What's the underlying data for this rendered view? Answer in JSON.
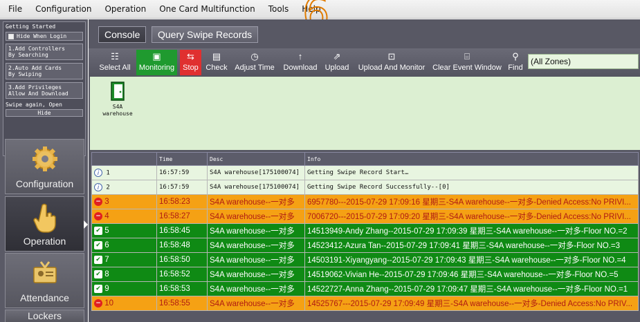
{
  "menu": [
    "File",
    "Configuration",
    "Operation",
    "One Card Multifunction",
    "Tools",
    "Help"
  ],
  "overlay_number": "6",
  "getting_started": {
    "title": "Getting Started",
    "hide_when_login": "Hide When Login",
    "steps": [
      "1.Add Controllers\nBy Searching",
      "2.Auto Add Cards\nBy Swiping",
      "3.Add Privileges\nAllow And Download"
    ],
    "note": "Swipe again, Open",
    "hide_label": "Hide"
  },
  "nav": {
    "configuration": "Configuration",
    "operation": "Operation",
    "attendance": "Attendance",
    "lockers": "Lockers"
  },
  "tabs": {
    "console": "Console",
    "query": "Query Swipe Records"
  },
  "toolbar": {
    "select_all": "Select All",
    "monitoring": "Monitoring",
    "stop": "Stop",
    "check": "Check",
    "adjust_time": "Adjust Time",
    "download": "Download",
    "upload": "Upload",
    "upload_and_monitor": "Upload And Monitor",
    "clear_event_window": "Clear Event Window",
    "find": "Find",
    "zones_value": "(All Zones)"
  },
  "device": {
    "label": "S4A\nwarehouse"
  },
  "grid": {
    "columns": [
      "",
      "Time",
      "Desc",
      "Info"
    ],
    "rows": [
      {
        "status": "info",
        "no": "1",
        "time": "16:57:59",
        "desc": "S4A warehouse[175100074]",
        "info": "Getting Swipe Record Start…"
      },
      {
        "status": "info",
        "no": "2",
        "time": "16:57:59",
        "desc": "S4A warehouse[175100074]",
        "info": "Getting Swipe Record Successfully--[0]"
      },
      {
        "status": "denied",
        "no": "3",
        "time": "16:58:23",
        "desc": "S4A warehouse--一对多",
        "info": "6957780---2015-07-29 17:09:16 星期三-S4A warehouse--一对多-Denied Access:No PRIVI..."
      },
      {
        "status": "denied",
        "no": "4",
        "time": "16:58:27",
        "desc": "S4A warehouse--一对多",
        "info": "7006720---2015-07-29 17:09:20 星期三-S4A warehouse--一对多-Denied Access:No PRIVI..."
      },
      {
        "status": "ok",
        "no": "5",
        "time": "16:58:45",
        "desc": "S4A warehouse--一对多",
        "info": "14513949-Andy Zhang--2015-07-29 17:09:39 星期三-S4A warehouse--一对多-Floor NO.=2"
      },
      {
        "status": "ok",
        "no": "6",
        "time": "16:58:48",
        "desc": "S4A warehouse--一对多",
        "info": "14523412-Azura Tan--2015-07-29 17:09:41 星期三-S4A warehouse--一对多-Floor NO.=3"
      },
      {
        "status": "ok",
        "no": "7",
        "time": "16:58:50",
        "desc": "S4A warehouse--一对多",
        "info": "14503191-Xiyangyang--2015-07-29 17:09:43 星期三-S4A warehouse--一对多-Floor NO.=4"
      },
      {
        "status": "ok",
        "no": "8",
        "time": "16:58:52",
        "desc": "S4A warehouse--一对多",
        "info": "14519062-Vivian He--2015-07-29 17:09:46 星期三-S4A warehouse--一对多-Floor NO.=5"
      },
      {
        "status": "ok",
        "no": "9",
        "time": "16:58:53",
        "desc": "S4A warehouse--一对多",
        "info": "14522727-Anna Zhang--2015-07-29 17:09:47 星期三-S4A warehouse--一对多-Floor NO.=1"
      },
      {
        "status": "denied",
        "no": "10",
        "time": "16:58:55",
        "desc": "S4A warehouse--一对多",
        "info": "14525767---2015-07-29 17:09:49 星期三-S4A warehouse--一对多-Denied Access:No PRIV..."
      }
    ]
  },
  "colors": {
    "ok": "#0f8a14",
    "denied": "#f5a114",
    "info": "#e8f5e0",
    "accent": "#f6a12c"
  }
}
